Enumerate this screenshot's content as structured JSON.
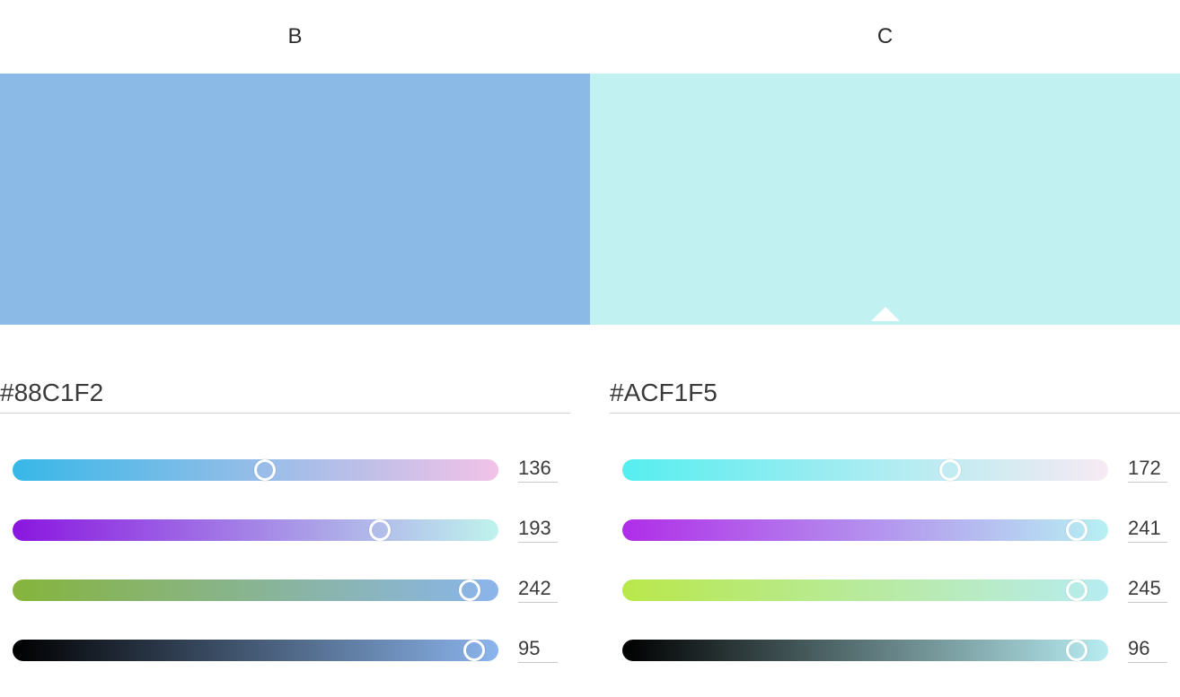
{
  "columns": [
    {
      "label": "B",
      "swatch_color": "#8cbae7",
      "selected": false,
      "hex": "#88C1F2",
      "sliders": [
        {
          "value": "136",
          "max": 255,
          "thumb_pct": 52.0,
          "gradient_from": "#37b8e8",
          "gradient_to": "#f2c2e8"
        },
        {
          "value": "193",
          "max": 255,
          "thumb_pct": 75.6,
          "gradient_from": "#8a16e0",
          "gradient_to": "#bff3ed"
        },
        {
          "value": "242",
          "max": 255,
          "thumb_pct": 94.0,
          "gradient_from": "#86b43b",
          "gradient_to": "#8bb5ec"
        },
        {
          "value": "95",
          "max": 100,
          "thumb_pct": 95.0,
          "gradient_from": "#000000",
          "gradient_to": "#8bb5ec"
        }
      ]
    },
    {
      "label": "C",
      "swatch_color": "#c2f1f1",
      "selected": true,
      "hex": "#ACF1F5",
      "sliders": [
        {
          "value": "172",
          "max": 255,
          "thumb_pct": 67.4,
          "gradient_from": "#56eef0",
          "gradient_to": "#f7eaf3"
        },
        {
          "value": "241",
          "max": 255,
          "thumb_pct": 93.5,
          "gradient_from": "#b02de8",
          "gradient_to": "#b7f0f3"
        },
        {
          "value": "245",
          "max": 255,
          "thumb_pct": 93.5,
          "gradient_from": "#b9e84a",
          "gradient_to": "#b7ecf1"
        },
        {
          "value": "96",
          "max": 100,
          "thumb_pct": 93.5,
          "gradient_from": "#000000",
          "gradient_to": "#b7ecf1"
        }
      ]
    }
  ]
}
